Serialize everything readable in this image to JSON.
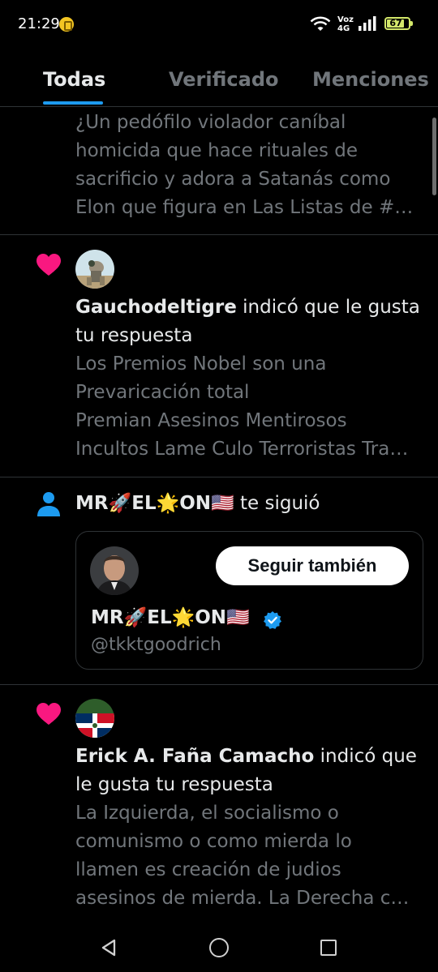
{
  "status_bar": {
    "time": "21:29",
    "network_line1": "Voz",
    "network_line2": "4G",
    "battery": "67"
  },
  "tabs": [
    {
      "label": "Todas",
      "active": true
    },
    {
      "label": "Verificado",
      "active": false
    },
    {
      "label": "Menciones",
      "active": false
    }
  ],
  "notifications": {
    "first_post": {
      "lines": [
        "¿Un pedófilo violador caníbal",
        "homicida que hace rituales de",
        "sacrificio y adora a Satanás como",
        "Elon que figura en Las Listas de #…"
      ]
    },
    "like1": {
      "icon": "heart-icon",
      "user": "Gauchodeltigre",
      "action_part1": " indicó que le gusta",
      "action_part2": "tu respuesta",
      "lines": [
        "Los Premios Nobel son una",
        "Prevaricación total",
        "Premian Asesinos Mentirosos",
        "Incultos Lame Culo Terroristas Tra…"
      ]
    },
    "follow": {
      "icon": "person-icon",
      "user": "MR🚀EL🌟ON🇺🇸",
      "action": " te siguió",
      "card": {
        "name": "MR🚀EL🌟ON🇺🇸",
        "handle": "@tkktgoodrich",
        "button": "Seguir también"
      }
    },
    "like2": {
      "icon": "heart-icon",
      "user": "Erick A. Faña Camacho",
      "action_part1": " indicó que",
      "action_part2": "le gusta tu respuesta",
      "lines": [
        "La Izquierda, el socialismo o",
        "comunismo o como mierda lo",
        "llamen es creación de judios",
        "asesinos de mierda. La Derecha c…"
      ]
    }
  },
  "colors": {
    "accent": "#1d9bf0",
    "heart": "#f91880",
    "muted": "#71767b",
    "text": "#e7e9ea"
  }
}
